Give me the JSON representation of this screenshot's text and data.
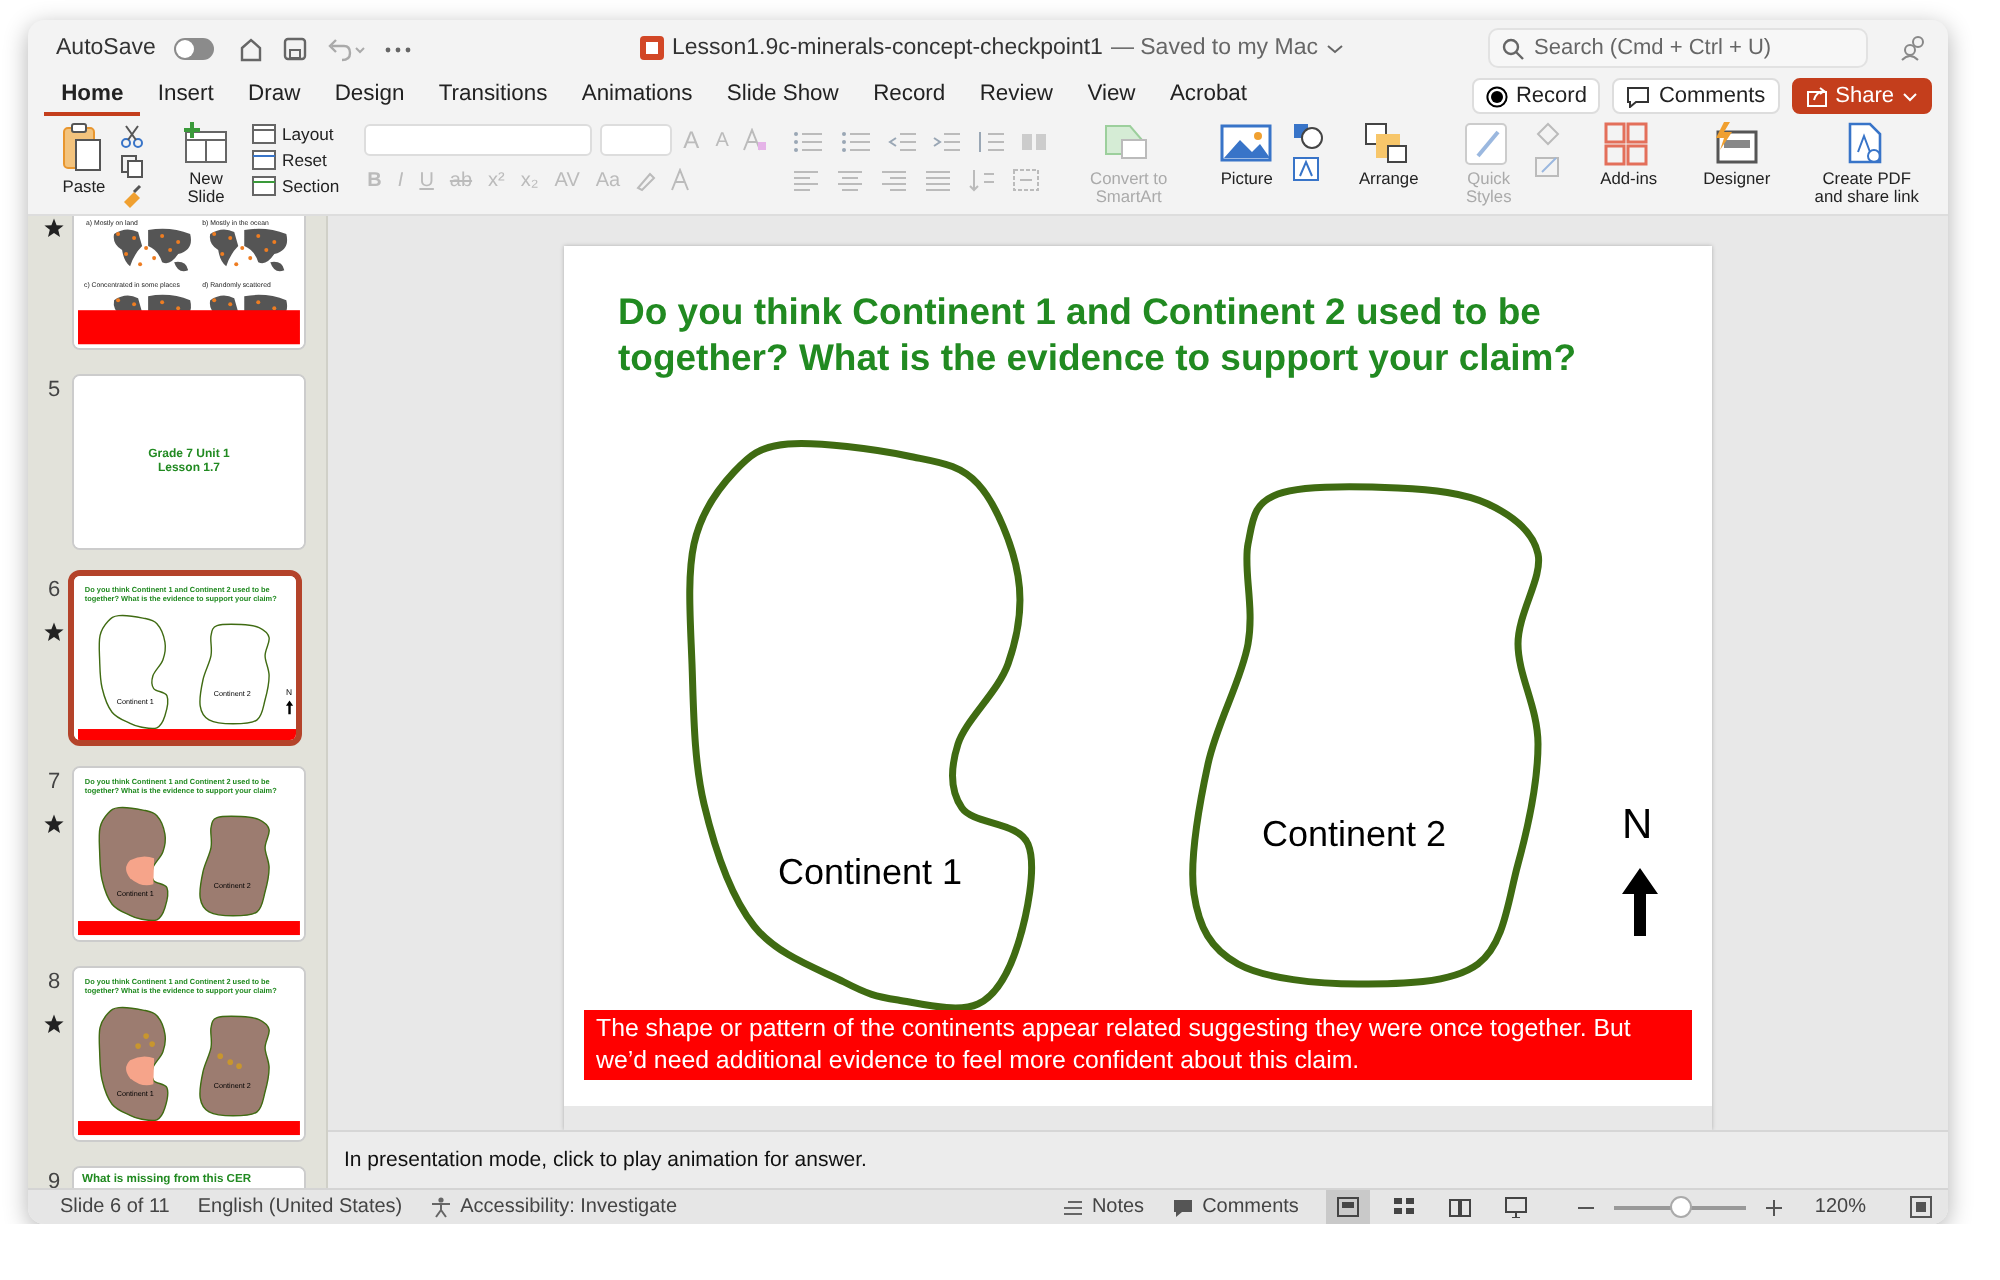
{
  "title_bar": {
    "autosave_label": "AutoSave",
    "autosave_on": false,
    "document_title": "Lesson1.9c-minerals-concept-checkpoint1",
    "save_status": "— Saved to my Mac",
    "search_placeholder": "Search (Cmd + Ctrl + U)"
  },
  "ribbon_tabs": [
    {
      "label": "Home",
      "selected": true
    },
    {
      "label": "Insert",
      "selected": false
    },
    {
      "label": "Draw",
      "selected": false
    },
    {
      "label": "Design",
      "selected": false
    },
    {
      "label": "Transitions",
      "selected": false
    },
    {
      "label": "Animations",
      "selected": false
    },
    {
      "label": "Slide Show",
      "selected": false
    },
    {
      "label": "Record",
      "selected": false
    },
    {
      "label": "Review",
      "selected": false
    },
    {
      "label": "View",
      "selected": false
    },
    {
      "label": "Acrobat",
      "selected": false
    }
  ],
  "ribbon_actions": [
    {
      "kind": "record",
      "label": "Record"
    },
    {
      "kind": "comments",
      "label": "Comments"
    },
    {
      "kind": "share",
      "label": "Share"
    }
  ],
  "ribbon": {
    "paste": "Paste",
    "new_slide": "New Slide",
    "slide_commands": [
      "Layout",
      "Reset",
      "Section"
    ],
    "size_buttons": [
      {
        "label": "A",
        "disabled": true
      },
      {
        "label": "A",
        "disabled": true
      }
    ],
    "format_buttons": [
      {
        "label": "B",
        "disabled": true
      },
      {
        "label": "I",
        "disabled": true
      },
      {
        "label": "U",
        "disabled": true
      },
      {
        "label": "ab",
        "disabled": true
      },
      {
        "label": "x²",
        "disabled": true
      },
      {
        "label": "x₂",
        "disabled": true
      },
      {
        "label": "AV",
        "disabled": true
      },
      {
        "label": "Aa",
        "disabled": true
      }
    ],
    "large_commands": [
      {
        "kind": "smartart",
        "label": "Convert to SmartArt",
        "disabled": true
      },
      {
        "kind": "picture",
        "label": "Picture",
        "disabled": false
      },
      {
        "kind": "arrange",
        "label": "Arrange",
        "disabled": false
      },
      {
        "kind": "styles",
        "label": "Quick Styles",
        "disabled": true
      },
      {
        "kind": "addins",
        "label": "Add-ins",
        "disabled": false
      },
      {
        "kind": "designer",
        "label": "Designer",
        "disabled": false
      },
      {
        "kind": "pdf",
        "label": "Create PDF and share link",
        "disabled": false
      }
    ]
  },
  "slides": [
    {
      "kind": "maps",
      "selected": false,
      "animated": true,
      "captions": [
        "a) Mostly on land",
        "b) Mostly in the ocean",
        "c) Concentrated in some places",
        "d) Randomly scattered"
      ]
    },
    {
      "number": "5",
      "kind": "title",
      "selected": false,
      "animated": false,
      "lines": [
        "Grade 7 Unit 1",
        "Lesson 1.7"
      ]
    },
    {
      "number": "6",
      "kind": "continents",
      "selected": true,
      "animated": true,
      "heading": "Do you think Continent 1 and Continent 2 used to be together? What is the evidence to support your claim?",
      "labels": [
        "Continent 1",
        "Continent 2"
      ],
      "compass": "N"
    },
    {
      "number": "7",
      "kind": "continents-shaded",
      "selected": false,
      "animated": true,
      "heading": "Do you think Continent 1 and Continent 2 used to be together? What is the evidence to support your claim?",
      "labels": [
        "Continent 1",
        "Continent 2"
      ]
    },
    {
      "number": "8",
      "kind": "continents-fossils",
      "selected": false,
      "animated": true,
      "heading": "Do you think Continent 1 and Continent 2 used to be together? What is the evidence to support your claim?",
      "labels": [
        "Continent 1",
        "Continent 2"
      ]
    },
    {
      "number": "9",
      "kind": "heading",
      "selected": false,
      "heading": "What is missing from this CER"
    }
  ],
  "editor_slide": {
    "kind": "continents",
    "heading": "Do you think Continent 1 and Continent 2 used to be together? What is the evidence to support your claim?",
    "labels": [
      "Continent 1",
      "Continent 2"
    ],
    "compass": "N",
    "caption": "The shape or pattern of the continents appear related suggesting they were once together.  But we’d need additional evidence to feel more confident about this claim."
  },
  "notes": "In presentation mode, click to play animation for answer.",
  "status_bar": {
    "slide_position": "Slide 6 of 11",
    "language": "English (United States)",
    "accessibility": "Accessibility: Investigate",
    "notes_button": "Notes",
    "comments_button": "Comments",
    "views": [
      {
        "kind": "normal",
        "selected": true
      },
      {
        "kind": "sorter",
        "selected": false
      },
      {
        "kind": "reading",
        "selected": false
      },
      {
        "kind": "slideshow",
        "selected": false
      }
    ],
    "zoom": {
      "level": 0.5,
      "reading": "120%"
    }
  }
}
